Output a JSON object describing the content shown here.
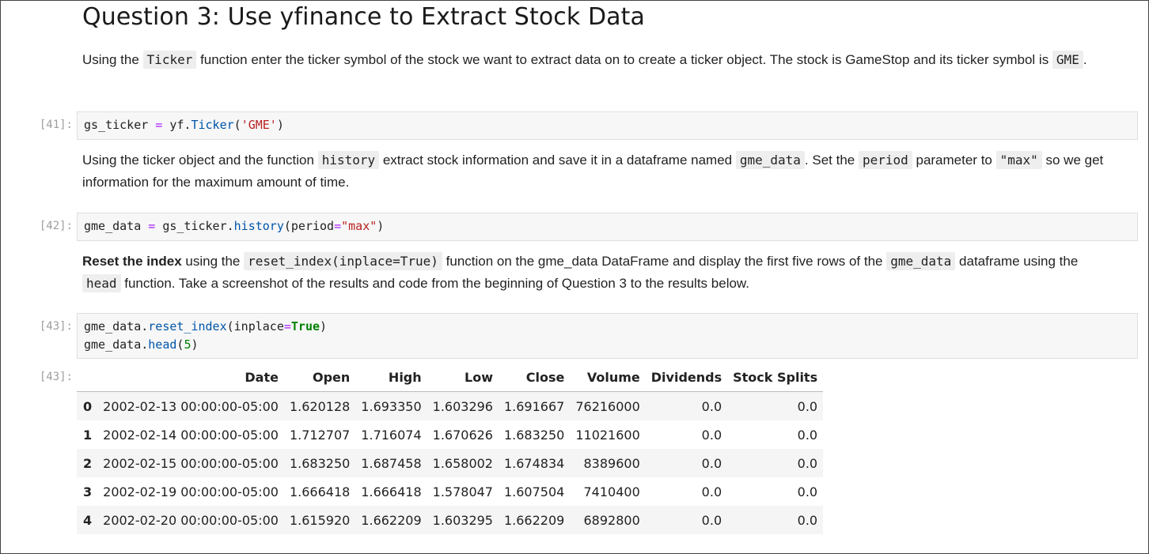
{
  "heading": "Question 3: Use yfinance to Extract Stock Data",
  "md1": {
    "t1": "Using the ",
    "c1": "Ticker",
    "t2": " function enter the ticker symbol of the stock we want to extract data on to create a ticker object. The stock is GameStop and its ticker symbol is ",
    "c2": "GME",
    "t3": "."
  },
  "md2": {
    "t1": "Using the ticker object and the function ",
    "c1": "history",
    "t2": " extract stock information and save it in a dataframe named ",
    "c2": "gme_data",
    "t3": ". Set the ",
    "c3": "period",
    "t4": " parameter to ",
    "c4": "\"max\"",
    "t5": " so we get information for the maximum amount of time."
  },
  "md3": {
    "bold": "Reset the index",
    "t1": " using the ",
    "c1": "reset_index(inplace=True)",
    "t2": " function on the gme_data DataFrame and display the first five rows of the ",
    "c2": "gme_data",
    "t3": " dataframe using the ",
    "c3": "head",
    "t4": " function. Take a screenshot of the results and code from the beginning of Question 3 to the results below."
  },
  "cells": {
    "c41": {
      "prompt": "[41]:",
      "var": "gs_ticker",
      "op": " = ",
      "obj": "yf.",
      "fn": "Ticker",
      "open": "(",
      "str": "'GME'",
      "close": ")"
    },
    "c42": {
      "prompt": "[42]:",
      "var": "gme_data",
      "op": " = ",
      "obj": "gs_ticker.",
      "fn": "history",
      "open": "(period",
      "eq": "=",
      "str": "\"max\"",
      "close": ")"
    },
    "c43": {
      "prompt": "[43]:",
      "l1_obj": "gme_data.",
      "l1_fn": "reset_index",
      "l1_open": "(inplace",
      "l1_eq": "=",
      "l1_kw": "True",
      "l1_close": ")",
      "l2_obj": "gme_data.",
      "l2_fn": "head",
      "l2_open": "(",
      "l2_num": "5",
      "l2_close": ")"
    },
    "out43": {
      "prompt": "[43]:"
    }
  },
  "table": {
    "columns": [
      "",
      "Date",
      "Open",
      "High",
      "Low",
      "Close",
      "Volume",
      "Dividends",
      "Stock Splits"
    ],
    "rows": [
      [
        "0",
        "2002-02-13 00:00:00-05:00",
        "1.620128",
        "1.693350",
        "1.603296",
        "1.691667",
        "76216000",
        "0.0",
        "0.0"
      ],
      [
        "1",
        "2002-02-14 00:00:00-05:00",
        "1.712707",
        "1.716074",
        "1.670626",
        "1.683250",
        "11021600",
        "0.0",
        "0.0"
      ],
      [
        "2",
        "2002-02-15 00:00:00-05:00",
        "1.683250",
        "1.687458",
        "1.658002",
        "1.674834",
        "8389600",
        "0.0",
        "0.0"
      ],
      [
        "3",
        "2002-02-19 00:00:00-05:00",
        "1.666418",
        "1.666418",
        "1.578047",
        "1.607504",
        "7410400",
        "0.0",
        "0.0"
      ],
      [
        "4",
        "2002-02-20 00:00:00-05:00",
        "1.615920",
        "1.662209",
        "1.603295",
        "1.662209",
        "6892800",
        "0.0",
        "0.0"
      ]
    ]
  }
}
